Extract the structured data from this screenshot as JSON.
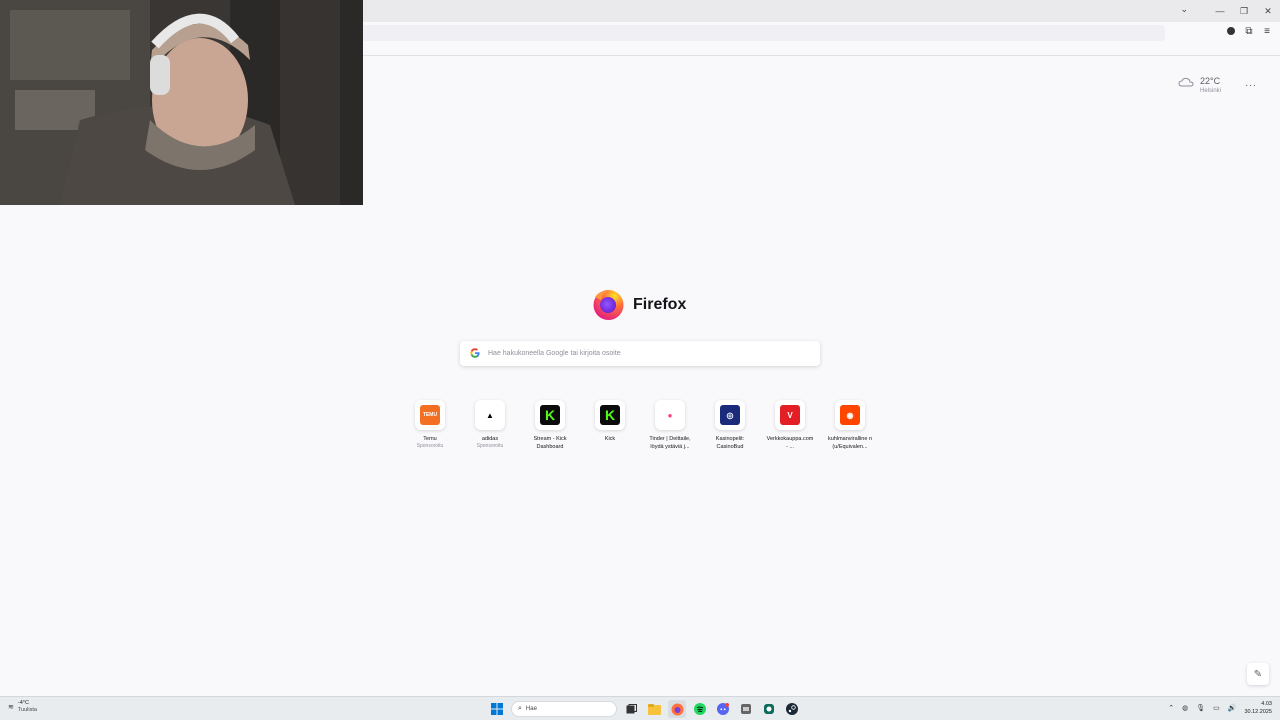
{
  "browser": {
    "brand_word": "Firefox",
    "search_placeholder": "Hae hakukoneella Google tai kirjoita osoite",
    "weather": {
      "temp": "22°C",
      "location": "Helsinki"
    },
    "menu_dots": "···"
  },
  "top_sites": [
    {
      "title": "Temu",
      "sub": "Sponsoroitu",
      "glyph": "TEMU",
      "color": "#f36f21"
    },
    {
      "title": "adidas",
      "sub": "Sponsoroitu",
      "glyph": "▲",
      "color": "#ffffff"
    },
    {
      "title": "Stream - Kick Dashboard",
      "sub": "",
      "glyph": "K",
      "color": "#0b0b0b"
    },
    {
      "title": "Kick",
      "sub": "",
      "glyph": "K",
      "color": "#0b0b0b"
    },
    {
      "title": "Tinder | Deittaile, löydä ystäviä j...",
      "sub": "",
      "glyph": "●",
      "color": "#ffffff"
    },
    {
      "title": "Kasinopelit: CasinoBud",
      "sub": "",
      "glyph": "◎",
      "color": "#1b2a7a"
    },
    {
      "title": "Verkkokauppa.com - ...",
      "sub": "",
      "glyph": "V",
      "color": "#e31e24"
    },
    {
      "title": "kuhlmanviralline n (u/Equivalen...",
      "sub": "",
      "glyph": "◉",
      "color": "#ff4500"
    }
  ],
  "taskbar": {
    "weather_temp": "-4°C",
    "weather_cond": "Tuulista",
    "search_label": "Hae",
    "time": "4.03",
    "date": "30.12.2025"
  },
  "icons": {
    "tab_list": "chevron-down-icon",
    "minimize": "minimize-icon",
    "restore": "restore-icon",
    "close": "close-icon"
  }
}
